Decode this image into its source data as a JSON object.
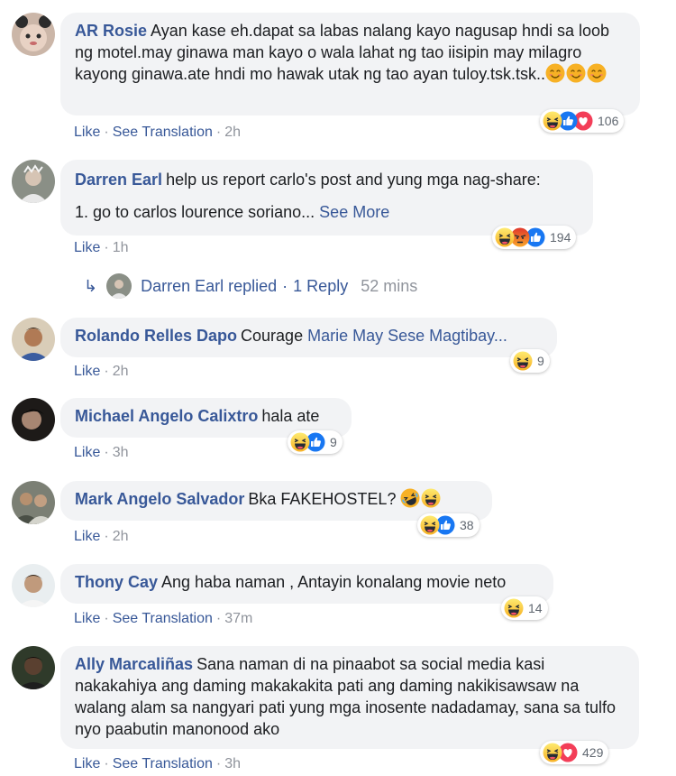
{
  "comments": [
    {
      "author": "AR Rosie",
      "text": "Ayan kase eh.dapat sa labas nalang kayo nagusap hndi sa loob ng motel.may ginawa man kayo o wala lahat ng tao iisipin may milagro kayong ginawa.ate hndi mo hawak utak ng tao ayan tuloy.tsk.tsk..",
      "inline_emojis": [
        "smiling-face-icon",
        "smiling-face-icon",
        "smiling-face-icon"
      ],
      "like": "Like",
      "translation": "See Translation",
      "time": "2h",
      "reactions": [
        "haha-icon",
        "like-icon",
        "love-icon"
      ],
      "reaction_count": "106"
    },
    {
      "author": "Darren Earl",
      "text_line1": "help us report carlo's post and yung mga nag-share:",
      "text_line2": "1. go to carlos lourence soriano...",
      "see_more": "See More",
      "like": "Like",
      "time": "1h",
      "reactions": [
        "haha-icon",
        "angry-icon",
        "like-icon"
      ],
      "reaction_count": "194",
      "reply": {
        "who": "Darren Earl replied",
        "separator": "·",
        "count": "1 Reply",
        "time": "52 mins"
      }
    },
    {
      "author": "Rolando Relles Dapo",
      "text": "Courage",
      "mention": "Marie May Sese Magtibay...",
      "like": "Like",
      "time": "2h",
      "reactions": [
        "haha-icon"
      ],
      "reaction_count": "9"
    },
    {
      "author": "Michael Angelo Calixtro",
      "text": "hala ate",
      "like": "Like",
      "time": "3h",
      "reactions": [
        "haha-icon",
        "like-icon"
      ],
      "reaction_count": "9"
    },
    {
      "author": "Mark Angelo Salvador",
      "text": "Bka FAKEHOSTEL?",
      "inline_emojis": [
        "rolling-laughing-icon",
        "haha-icon"
      ],
      "like": "Like",
      "time": "2h",
      "reactions": [
        "haha-icon",
        "like-icon"
      ],
      "reaction_count": "38"
    },
    {
      "author": "Thony Cay",
      "text": "Ang haba naman , Antayin konalang movie neto",
      "like": "Like",
      "translation": "See Translation",
      "time": "37m",
      "reactions": [
        "haha-icon"
      ],
      "reaction_count": "14"
    },
    {
      "author": "Ally Marcaliñas",
      "text": "Sana naman di na pinaabot sa social media kasi nakakahiya ang daming makakakita pati ang daming nakikisawsaw na walang alam sa nangyari pati yung mga inosente nadadamay, sana sa tulfo nyo paabutin manonood ako",
      "like": "Like",
      "translation": "See Translation",
      "time": "3h",
      "reactions": [
        "haha-icon",
        "love-icon"
      ],
      "reaction_count": "429"
    }
  ],
  "dot": "·",
  "colors": {
    "link": "#385898",
    "bubble": "#f2f3f5",
    "meta": "#90949c",
    "haha": "#f7b125",
    "like": "#1877f2",
    "love": "#f33e58",
    "angry": "#e9710f"
  }
}
